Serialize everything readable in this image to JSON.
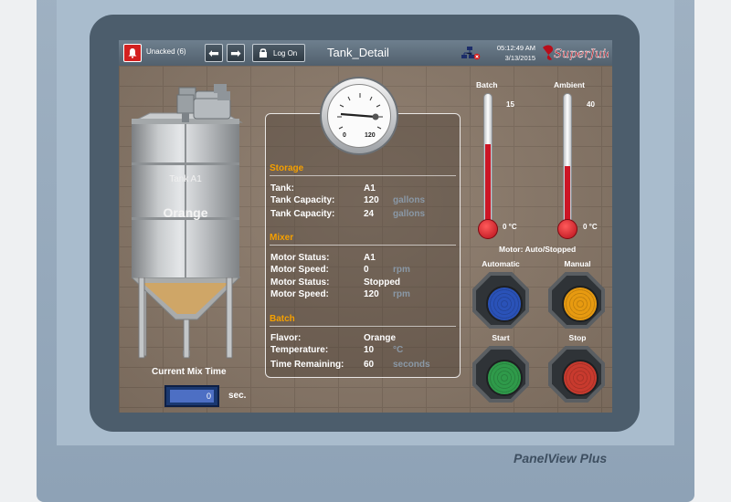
{
  "header": {
    "alarm_label": "Unacked (6)",
    "logon_label": "Log On",
    "title": "Tank_Detail",
    "time": "05:12:49 AM",
    "date": "3/13/2015",
    "logo_text": "SuperJuice"
  },
  "tank": {
    "label": "Tank A1",
    "flavor": "Orange",
    "mix_time_label": "Current Mix Time",
    "mix_time_value": "0",
    "mix_time_unit": "sec."
  },
  "gauge": {
    "min": "0",
    "max": "120"
  },
  "storage": {
    "heading": "Storage",
    "rows": [
      {
        "key": "Tank:",
        "value": "A1",
        "unit": ""
      },
      {
        "key": "Tank Capacity:",
        "value": "120",
        "unit": "gallons"
      },
      {
        "key": "Tank Capacity:",
        "value": "24",
        "unit": "gallons"
      }
    ]
  },
  "mixer": {
    "heading": "Mixer",
    "rows": [
      {
        "key": "Motor Status:",
        "value": "A1",
        "unit": ""
      },
      {
        "key": "Motor Speed:",
        "value": "0",
        "unit": "rpm"
      },
      {
        "key": "Motor Status:",
        "value": "Stopped",
        "unit": ""
      },
      {
        "key": "Motor Speed:",
        "value": "120",
        "unit": "rpm"
      }
    ]
  },
  "batch": {
    "heading": "Batch",
    "rows": [
      {
        "key": "Flavor:",
        "value": "Orange",
        "unit": ""
      },
      {
        "key": "Temperature:",
        "value": "10",
        "unit": "°C"
      },
      {
        "key": "Time Remaining:",
        "value": "60",
        "unit": "seconds"
      }
    ]
  },
  "thermometers": {
    "batch": {
      "title": "Batch",
      "value": "15",
      "min_label": "0 °C",
      "fill_fraction": 0.62
    },
    "ambient": {
      "title": "Ambient",
      "value": "40",
      "min_label": "0 °C",
      "fill_fraction": 0.45
    }
  },
  "controls": {
    "motor_status": "Motor: Auto/Stopped",
    "automatic_label": "Automatic",
    "manual_label": "Manual",
    "start_label": "Start",
    "stop_label": "Stop"
  },
  "colors": {
    "accent_heading": "#f5a000",
    "automatic_lamp": "#2a52b8",
    "manual_lamp": "#e79a10",
    "start_lamp": "#2f9a4a",
    "stop_lamp": "#c83a2e"
  },
  "device": {
    "brand": "PanelView Plus"
  }
}
